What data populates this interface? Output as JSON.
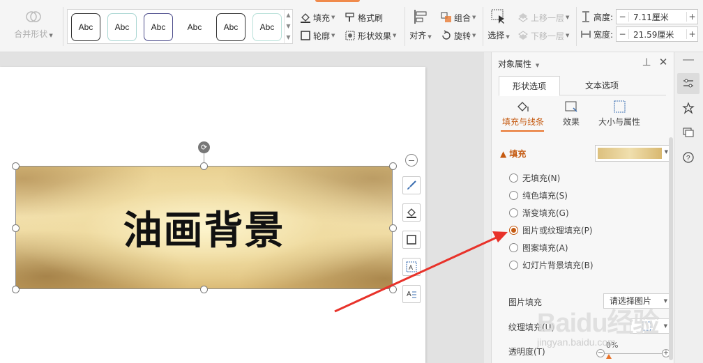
{
  "ribbon": {
    "merge_shapes_label": "合并形状",
    "style_swatches": [
      "Abc",
      "Abc",
      "Abc",
      "Abc",
      "Abc",
      "Abc"
    ],
    "fill_label": "填充",
    "outline_label": "轮廓",
    "format_painter_label": "格式刷",
    "shape_effects_label": "形状效果",
    "align_label": "对齐",
    "group_label": "组合",
    "rotate_label": "旋转",
    "select_label": "选择",
    "bring_forward_label": "上移一层",
    "send_backward_label": "下移一层",
    "height_label": "高度:",
    "height_value": "7.11厘米",
    "width_label": "宽度:",
    "width_value": "21.59厘米"
  },
  "slide": {
    "shape_text": "油画背景"
  },
  "panel": {
    "title": "对象属性",
    "tabs": [
      "形状选项",
      "文本选项"
    ],
    "subtabs": [
      "填充与线条",
      "效果",
      "大小与属性"
    ],
    "fill_section": "填充",
    "fill_options": [
      {
        "label": "无填充(N)",
        "checked": false
      },
      {
        "label": "纯色填充(S)",
        "checked": false
      },
      {
        "label": "渐变填充(G)",
        "checked": false
      },
      {
        "label": "图片或纹理填充(P)",
        "checked": true
      },
      {
        "label": "图案填充(A)",
        "checked": false
      },
      {
        "label": "幻灯片背景填充(B)",
        "checked": false
      }
    ],
    "picture_fill_label": "图片填充",
    "picture_fill_value": "请选择图片",
    "texture_fill_label": "纹理填充(U)",
    "transparency_label": "透明度(T)",
    "transparency_value": "0%"
  },
  "watermark": {
    "brand": "Baidu经验",
    "url": "jingyan.baidu.com"
  },
  "colors": {
    "accent": "#c55a11",
    "accent_light": "#e8732a",
    "arrow": "#e8322a"
  }
}
